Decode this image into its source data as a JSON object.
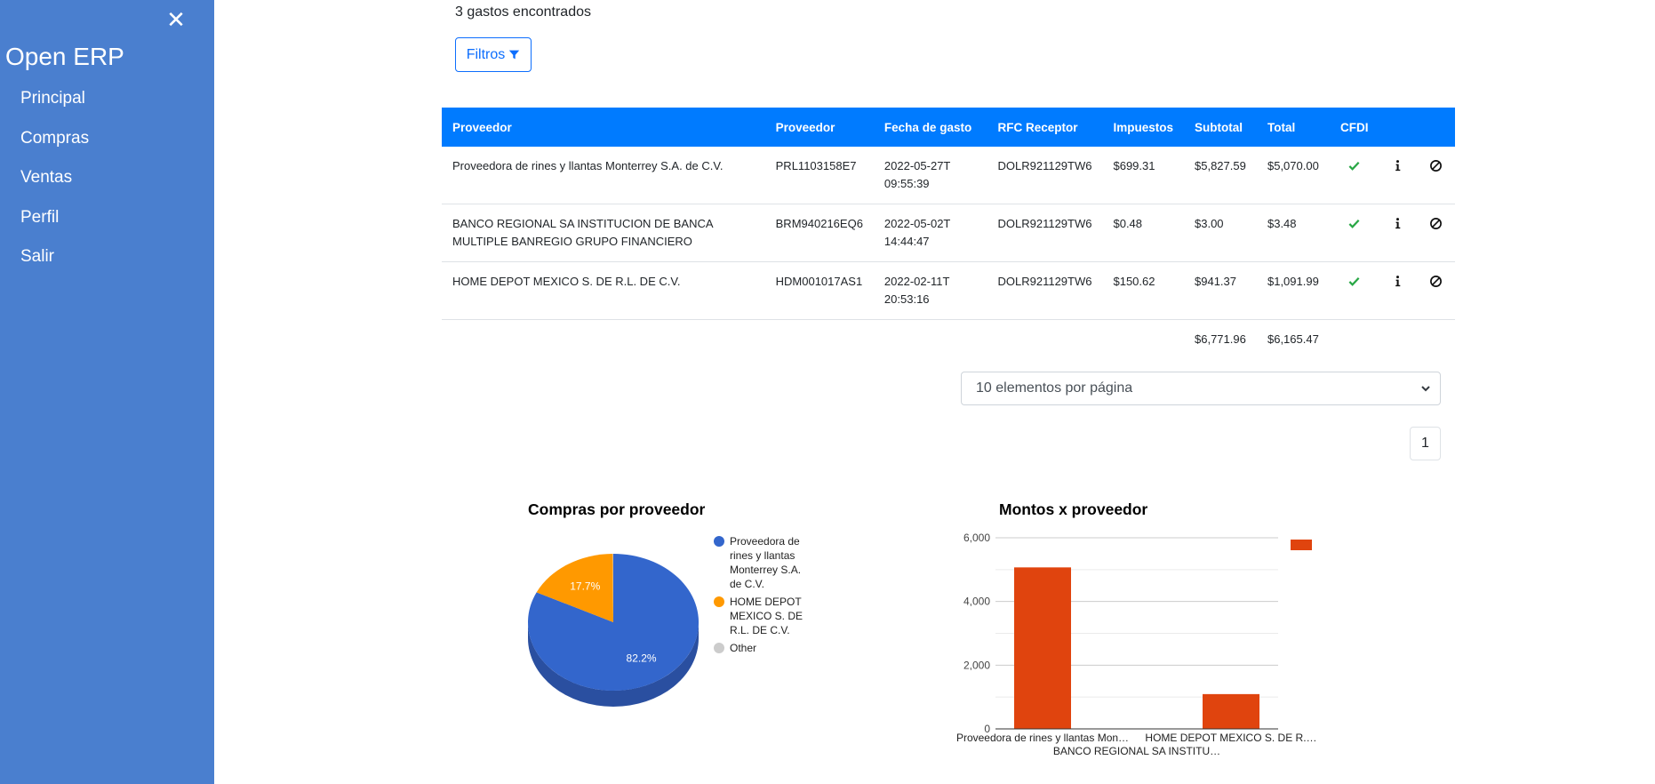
{
  "sidebar": {
    "close_icon": "close-icon",
    "brand": "Open ERP",
    "items": [
      {
        "label": "Principal"
      },
      {
        "label": "Compras"
      },
      {
        "label": "Ventas"
      },
      {
        "label": "Perfil"
      },
      {
        "label": "Salir"
      }
    ]
  },
  "main": {
    "count_text": "3 gastos encontrados",
    "filter_label": "Filtros",
    "filter_icon": "filter-icon",
    "table": {
      "columns": [
        "Proveedor",
        "Proveedor",
        "Fecha de gasto",
        "RFC Receptor",
        "Impuestos",
        "Subtotal",
        "Total",
        "CFDI"
      ],
      "rows": [
        {
          "proveedor": "Proveedora de rines y llantas Monterrey S.A. de C.V.",
          "rfc_emisor": "PRL1103158E7",
          "fecha": "2022-05-27T09:55:39",
          "rfc_receptor": "DOLR921129TW6",
          "impuestos": "$699.31",
          "subtotal": "$5,827.59",
          "total": "$5,070.00",
          "cfdi": "check-icon"
        },
        {
          "proveedor": "BANCO REGIONAL SA INSTITUCION DE BANCA MULTIPLE BANREGIO GRUPO FINANCIERO",
          "rfc_emisor": "BRM940216EQ6",
          "fecha": "2022-05-02T14:44:47",
          "rfc_receptor": "DOLR921129TW6",
          "impuestos": "$0.48",
          "subtotal": "$3.00",
          "total": "$3.48",
          "cfdi": "check-icon"
        },
        {
          "proveedor": "HOME DEPOT MEXICO S. DE R.L. DE C.V.",
          "rfc_emisor": "HDM001017AS1",
          "fecha": "2022-02-11T20:53:16",
          "rfc_receptor": "DOLR921129TW6",
          "impuestos": "$150.62",
          "subtotal": "$941.37",
          "total": "$1,091.99",
          "cfdi": "check-icon"
        }
      ],
      "totals": {
        "subtotal": "$6,771.96",
        "total": "$6,165.47"
      }
    },
    "pagination": {
      "per_page_selected": "10 elementos por página",
      "current_page": "1"
    }
  },
  "colors": {
    "sidebar": "#4a7fcf",
    "header": "#007bff",
    "pie_blue": "#3366cc",
    "pie_orange": "#ff9900",
    "other_gray": "#cccccc",
    "bar": "#e0440e",
    "check": "#28a745"
  },
  "chart_data": [
    {
      "type": "pie",
      "title": "Compras por proveedor",
      "labels": [
        "Proveedora de rines y llantas Monterrey S.A. de C.V.",
        "HOME DEPOT MEXICO S. DE R.L. DE C.V.",
        "Other"
      ],
      "values": [
        82.2,
        17.7,
        0.1
      ],
      "slice_labels": [
        "82.2%",
        "17.7%"
      ],
      "legend_lines": [
        [
          "Proveedora de",
          "rines y llantas",
          "Monterrey S.A.",
          "de C.V."
        ],
        [
          "HOME DEPOT",
          "MEXICO S. DE",
          "R.L. DE C.V."
        ],
        [
          "Other"
        ]
      ],
      "legend": "right",
      "three_d": true
    },
    {
      "type": "bar",
      "title": "Montos x proveedor",
      "categories": [
        "Proveedora de rines y llantas Monterrey S.A. de C.V.",
        "BANCO REGIONAL SA INSTITUCION DE BANCA MULTIPLE BANREGIO GRUPO FINANCIERO",
        "HOME DEPOT MEXICO S. DE R.L. DE C.V."
      ],
      "category_labels": [
        "Proveedora de rines y llantas Mon…",
        "BANCO REGIONAL SA INSTITU…",
        "HOME DEPOT MEXICO S. DE R.…"
      ],
      "values": [
        5070,
        3.48,
        1091.99
      ],
      "ylim": [
        0,
        6000
      ],
      "yticks": [
        0,
        2000,
        4000,
        6000
      ],
      "ytick_labels": [
        "0",
        "2,000",
        "4,000",
        "6,000"
      ],
      "grid": true,
      "legend": "top-right"
    }
  ]
}
